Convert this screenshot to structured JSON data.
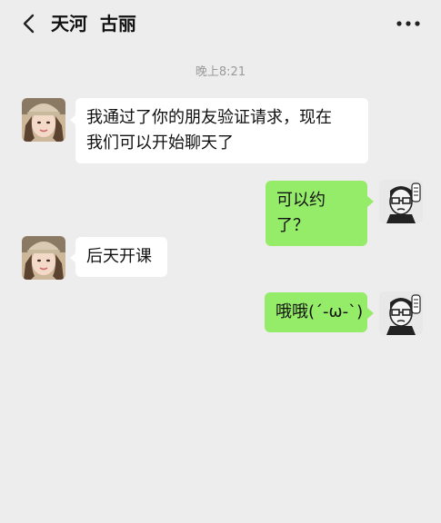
{
  "header": {
    "title": "天河  古丽",
    "back_icon": "chevron-left-icon",
    "more_icon": "more-horizontal-icon"
  },
  "timestamp": "晚上8:21",
  "messages": [
    {
      "side": "left",
      "text_lines": [
        "我通过了你的朋友验证请求，现在",
        "我们可以开始聊天了"
      ]
    },
    {
      "side": "right",
      "text": "可以约了？"
    },
    {
      "side": "left",
      "text": "后天开课"
    },
    {
      "side": "right",
      "text": "哦哦(´-ω-`)"
    }
  ],
  "colors": {
    "background": "#ededed",
    "incoming_bubble": "#ffffff",
    "outgoing_bubble": "#95ec69",
    "text": "#111111",
    "timestamp": "#9a9a9a"
  }
}
